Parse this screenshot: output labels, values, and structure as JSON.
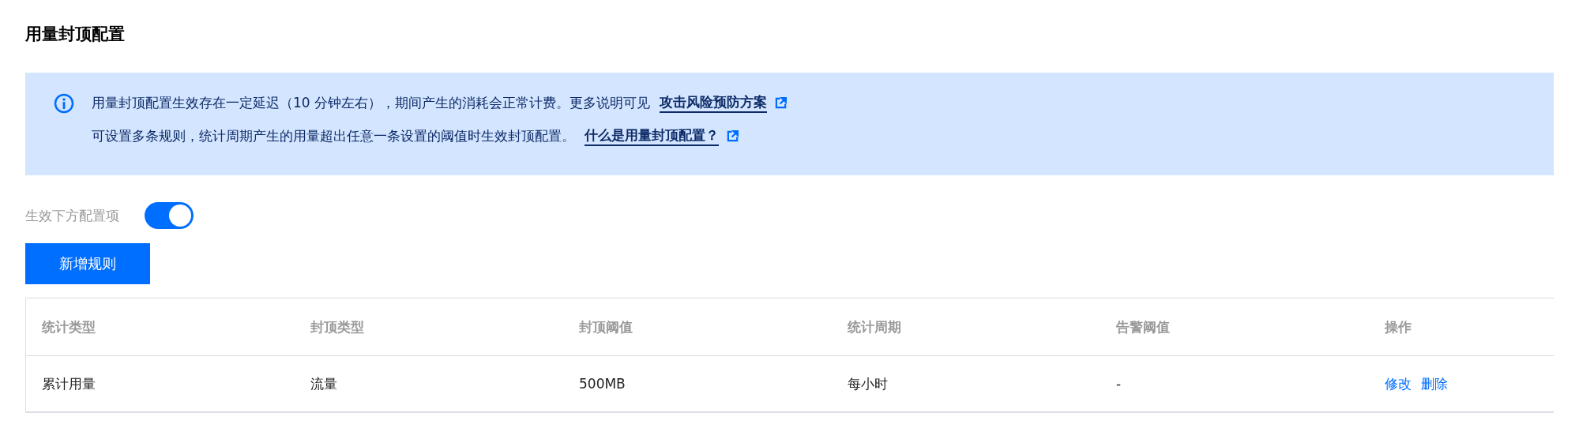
{
  "title": "用量封顶配置",
  "notice": {
    "lines": [
      {
        "text": "用量封顶配置生效存在一定延迟（10 分钟左右），期间产生的消耗会正常计费。更多说明可见",
        "link": "攻击风险预防方案"
      },
      {
        "text": "可设置多条规则，统计周期产生的用量超出任意一条设置的阈值时生效封顶配置。",
        "link": "什么是用量封顶配置？"
      }
    ]
  },
  "toggle": {
    "label": "生效下方配置项",
    "on": true
  },
  "add_button": "新增规则",
  "table": {
    "columns": [
      "统计类型",
      "封顶类型",
      "封顶阈值",
      "统计周期",
      "告警阈值",
      "操作"
    ],
    "rows": [
      {
        "cells": [
          "累计用量",
          "流量",
          "500MB",
          "每小时",
          "-"
        ],
        "actions": [
          "修改",
          "删除"
        ]
      }
    ]
  }
}
